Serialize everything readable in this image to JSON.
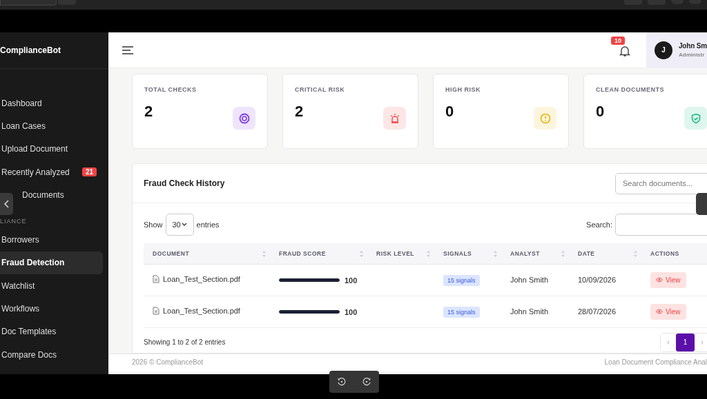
{
  "brand": "ComplianceBot",
  "sidebar": {
    "items": [
      {
        "label": "Dashboard",
        "selected": false
      },
      {
        "label": "Loan Cases",
        "selected": false
      },
      {
        "label": "Upload Document",
        "selected": false
      },
      {
        "label": "Recently Analyzed",
        "selected": false,
        "badge": "21"
      },
      {
        "label": "Documents",
        "selected": false
      }
    ],
    "section": "LIANCE",
    "items2": [
      {
        "label": "Borrowers",
        "selected": false
      },
      {
        "label": "Fraud Detection",
        "selected": true
      },
      {
        "label": "Watchlist",
        "selected": false
      },
      {
        "label": "Workflows",
        "selected": false
      },
      {
        "label": "Doc Templates",
        "selected": false
      },
      {
        "label": "Compare Docs",
        "selected": false
      }
    ]
  },
  "header": {
    "notifications": "10",
    "avatar": "J",
    "user_name": "John Sm",
    "user_role": "Administr"
  },
  "stats": [
    {
      "label": "TOTAL CHECKS",
      "value": "2",
      "kind": "target",
      "color": "#7c3aed"
    },
    {
      "label": "CRITICAL RISK",
      "value": "2",
      "kind": "siren",
      "color": "#ef4444"
    },
    {
      "label": "HIGH RISK",
      "value": "0",
      "kind": "alert",
      "color": "#eab308"
    },
    {
      "label": "CLEAN DOCUMENTS",
      "value": "0",
      "kind": "shield",
      "color": "#10b981"
    }
  ],
  "history": {
    "title": "Fraud Check History",
    "search_placeholder": "Search documents...",
    "show_label": "Show",
    "entries_value": "30",
    "entries_label": "entries",
    "search_label": "Search:",
    "columns": [
      "DOCUMENT",
      "FRAUD SCORE",
      "RISK LEVEL",
      "SIGNALS",
      "ANALYST",
      "DATE",
      "ACTIONS"
    ],
    "rows": [
      {
        "document": "Loan_Test_Section.pdf",
        "level": 1.0,
        "score": "100",
        "signals": "15 signals",
        "analyst": "John Smith",
        "date": "10/09/2026",
        "action": "View"
      },
      {
        "document": "Loan_Test_Section.pdf",
        "level": 1.0,
        "score": "100",
        "signals": "15 signals",
        "analyst": "John Smith",
        "date": "28/07/2026",
        "action": "View"
      }
    ],
    "info": "Showing 1 to 2 of 2 entries",
    "pages": [
      {
        "label": "1",
        "selected": true
      }
    ]
  },
  "footer": {
    "left": "2026 © ComplianceBot",
    "right": "Loan Document Compliance Anal"
  }
}
